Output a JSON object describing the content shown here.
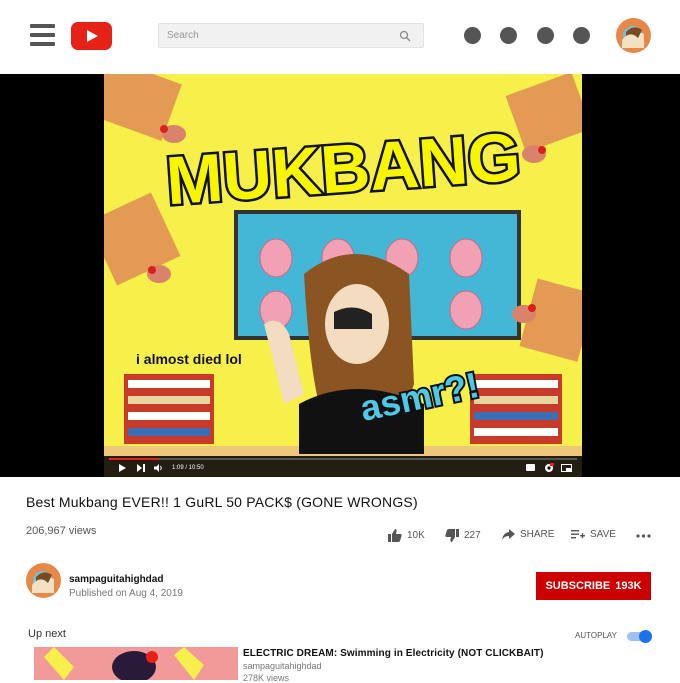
{
  "search": {
    "placeholder": "Search"
  },
  "player": {
    "time": "1:09 / 10:50",
    "progress": 0.106,
    "overlay": {
      "headline": "MUKBANG",
      "caption": "i almost died lol",
      "tag": "asmr?!"
    }
  },
  "video": {
    "title": "Best Mukbang EVER!! 1 GuRL 50 PACK$ (GONE WRONGS)",
    "views": "206,967 views",
    "likes": "10K",
    "dislikes": "227",
    "share_label": "SHARE",
    "save_label": "SAVE"
  },
  "channel": {
    "name": "sampaguitahighdad",
    "published": "Published on Aug 4, 2019",
    "subscribe_label": "SUBSCRIBE",
    "subscriber_count": "193K"
  },
  "upnext": {
    "heading": "Up next",
    "autoplay_label": "AUTOPLAY",
    "autoplay_on": true,
    "items": [
      {
        "title": "ELECTRIC DREAM: Swimming in Electricity (NOT CLICKBAIT)",
        "channel": "sampaguitahighdad",
        "views": "278K views"
      }
    ]
  },
  "colors": {
    "brand_red": "#e62117",
    "subscribe_red": "#cc0000",
    "video_yellow": "#f7ef4a",
    "toggle_blue": "#1a73e8"
  }
}
